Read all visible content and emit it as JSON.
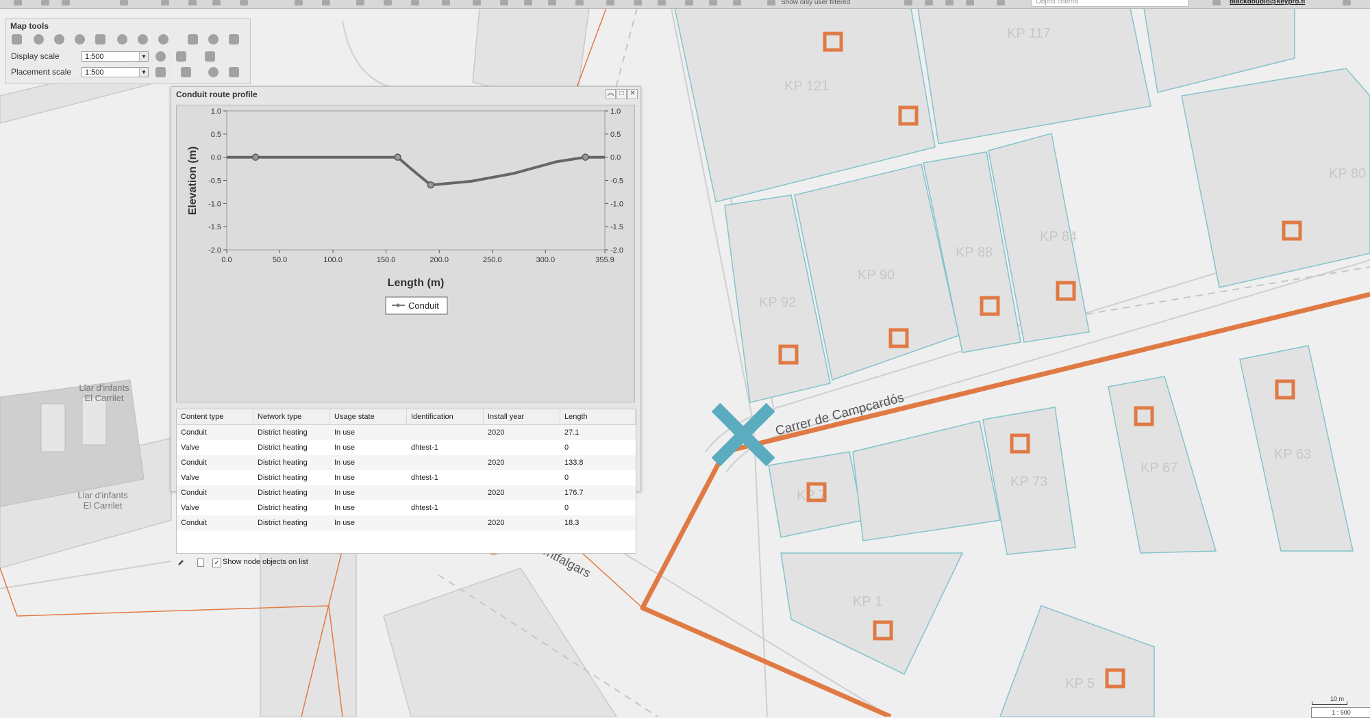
{
  "toolbar": {
    "filter_dropdown": "Show only user filtered",
    "search_placeholder": "Object criteria",
    "user": "blackdoublo@keypro.fi"
  },
  "map_tools": {
    "title": "Map tools",
    "display_scale_label": "Display scale",
    "display_scale_value": "1:500",
    "placement_scale_label": "Placement scale",
    "placement_scale_value": "1:500",
    "icons": [
      "hand-icon",
      "zoom-in-icon",
      "zoom-out-icon",
      "zoom-box-icon",
      "extent-icon",
      "back-icon",
      "forward-icon",
      "info-icon",
      "measure-icon",
      "refresh-icon",
      "window-icon",
      "layers-icon",
      "google-icon",
      "map-icon",
      "legend-icon",
      "print-icon",
      "locate-icon",
      "grid-icon"
    ]
  },
  "profile_panel": {
    "title": "Conduit route profile",
    "buttons": [
      "collapse-icon",
      "maximize-icon",
      "close-icon"
    ],
    "legend_label": "Conduit",
    "footer_checkbox_label": "Show node objects on list",
    "footer_checked": true,
    "table": {
      "columns": [
        "Content type",
        "Network type",
        "Usage state",
        "Identification",
        "Install year",
        "Length"
      ],
      "rows": [
        [
          "Conduit",
          "District heating",
          "In use",
          "",
          "2020",
          "27.1"
        ],
        [
          "Valve",
          "District heating",
          "In use",
          "dhtest-1",
          "",
          "0"
        ],
        [
          "Conduit",
          "District heating",
          "In use",
          "",
          "2020",
          "133.8"
        ],
        [
          "Valve",
          "District heating",
          "In use",
          "dhtest-1",
          "",
          "0"
        ],
        [
          "Conduit",
          "District heating",
          "In use",
          "",
          "2020",
          "176.7"
        ],
        [
          "Valve",
          "District heating",
          "In use",
          "dhtest-1",
          "",
          "0"
        ],
        [
          "Conduit",
          "District heating",
          "In use",
          "",
          "2020",
          "18.3"
        ]
      ]
    }
  },
  "chart_data": {
    "type": "line",
    "xlabel": "Length (m)",
    "ylabel": "Elevation (m)",
    "xlim": [
      0,
      355.9
    ],
    "ylim": [
      -2.0,
      1.0
    ],
    "x_ticks": [
      "0.0",
      "50.0",
      "100.0",
      "150.0",
      "200.0",
      "250.0",
      "300.0",
      "355.9"
    ],
    "y_ticks": [
      "1.0",
      "0.5",
      "0.0",
      "-0.5",
      "-1.0",
      "-1.5",
      "-2.0"
    ],
    "legend_placement": "bottom",
    "series": [
      {
        "name": "Conduit",
        "x": [
          0,
          27.1,
          160.9,
          175,
          192.0,
          230,
          270,
          310,
          337.6,
          355.9
        ],
        "y": [
          0.0,
          0.0,
          0.0,
          -0.28,
          -0.6,
          -0.52,
          -0.35,
          -0.1,
          0.0,
          0.0
        ],
        "nodes": [
          27.1,
          160.9,
          192.0,
          337.6
        ]
      }
    ]
  },
  "map": {
    "street_labels": [
      "Carrer de Campcardós",
      "Carrer del Montfalgars"
    ],
    "poi_labels": [
      "Llar d'infants El Carrilet",
      "Llar d'infants El Carrilet"
    ],
    "parcel_labels": [
      "KP 121",
      "KP 117",
      "KP 80",
      "KP 92",
      "KP 90",
      "KP 88",
      "KP 84",
      "KP 7",
      "KP 73",
      "KP 67",
      "KP 63",
      "KP 1",
      "KP 5"
    ],
    "scale_text": "10 m",
    "scale_ratio": "1 : 500",
    "colors": {
      "conduit": "#e07a44",
      "selection": "#5bacbf",
      "parcel_edge": "#83c3cc",
      "background": "#efefef"
    }
  }
}
